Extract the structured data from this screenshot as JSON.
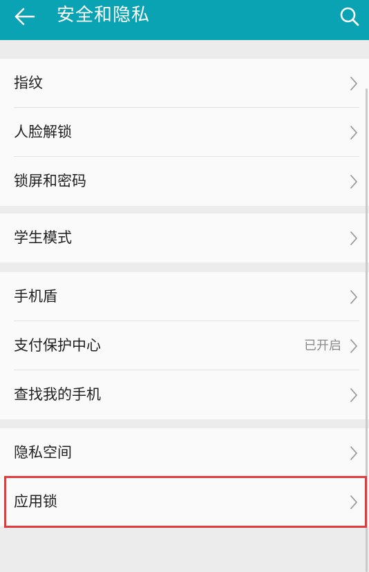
{
  "header": {
    "title": "安全和隐私",
    "back_icon": "arrow-left-icon",
    "search_icon": "search-icon",
    "background_color": "#0aa3b4"
  },
  "groups": [
    {
      "items": [
        {
          "label": "指纹"
        },
        {
          "label": "人脸解锁"
        },
        {
          "label": "锁屏和密码"
        }
      ]
    },
    {
      "items": [
        {
          "label": "学生模式"
        }
      ]
    },
    {
      "items": [
        {
          "label": "手机盾"
        },
        {
          "label": "支付保护中心",
          "status": "已开启"
        },
        {
          "label": "查找我的手机"
        }
      ]
    },
    {
      "items": [
        {
          "label": "隐私空间"
        },
        {
          "label": "应用锁"
        }
      ]
    }
  ],
  "highlight_color": "#e23a3a"
}
